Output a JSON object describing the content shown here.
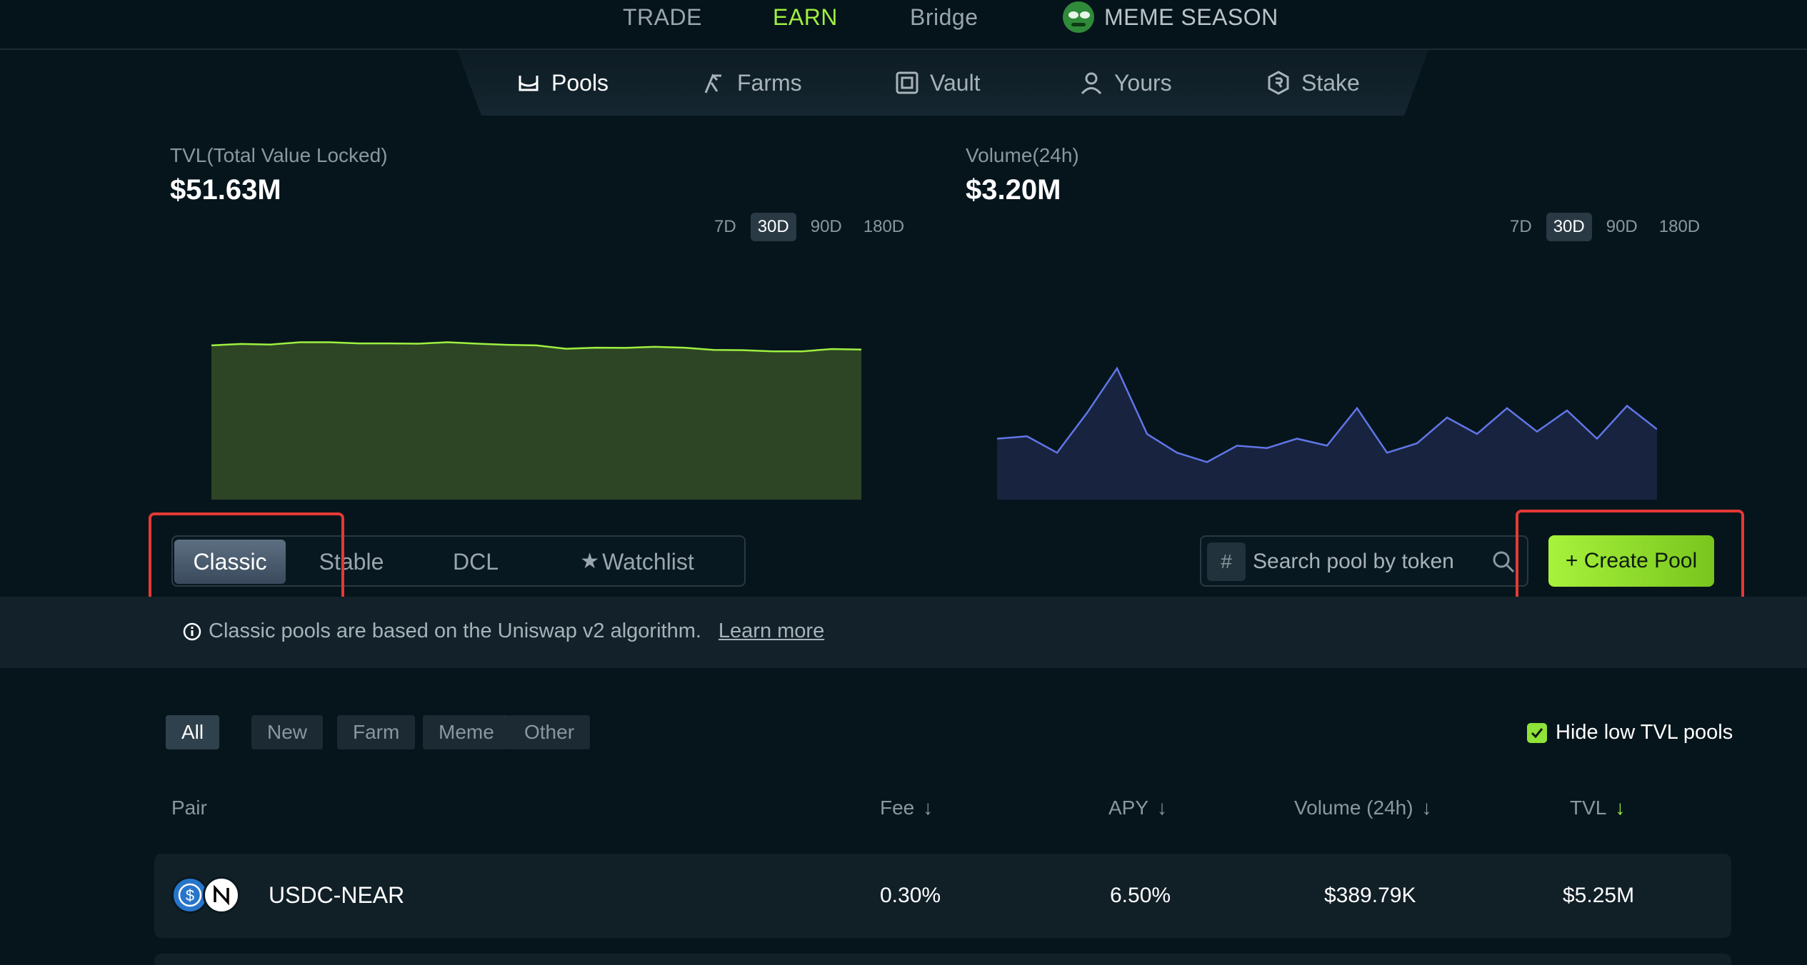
{
  "topnav": {
    "trade": "TRADE",
    "earn": "EARN",
    "bridge": "Bridge",
    "meme": "MEME SEASON"
  },
  "subnav": {
    "pools": "Pools",
    "farms": "Farms",
    "vault": "Vault",
    "yours": "Yours",
    "stake": "Stake"
  },
  "tvl": {
    "label": "TVL(Total Value Locked)",
    "value": "$51.63M",
    "ranges": [
      "7D",
      "30D",
      "90D",
      "180D"
    ],
    "selected_range": "30D"
  },
  "volume": {
    "label": "Volume(24h)",
    "value": "$3.20M",
    "ranges": [
      "7D",
      "30D",
      "90D",
      "180D"
    ],
    "selected_range": "30D"
  },
  "tvl_chart": {
    "type": "area",
    "color": "#9ef040",
    "fill": "#2d4524",
    "values": [
      54.5,
      55.0,
      54.8,
      55.6,
      55.6,
      55.2,
      55.2,
      55.1,
      55.6,
      55.1,
      54.7,
      54.5,
      53.3,
      53.7,
      53.6,
      54.0,
      53.7,
      52.9,
      52.8,
      52.4,
      52.4,
      53.2,
      53.0
    ]
  },
  "volume_chart": {
    "type": "area",
    "color": "#6176e8",
    "fill": "#18233f",
    "values": [
      2.6,
      2.7,
      2.0,
      3.7,
      5.6,
      2.8,
      2.0,
      1.6,
      2.3,
      2.2,
      2.6,
      2.3,
      3.9,
      2.0,
      2.4,
      3.5,
      2.8,
      3.9,
      2.9,
      3.8,
      2.6,
      4.0,
      3.0
    ]
  },
  "tabs": [
    "Classic",
    "Stable",
    "DCL",
    "Watchlist"
  ],
  "active_tab": "Classic",
  "search": {
    "placeholder": "Search pool by token",
    "hash": "#"
  },
  "create_pool": "+ Create Pool",
  "info": {
    "text": "Classic pools are based on the Uniswap v2 algorithm.",
    "link": "Learn more"
  },
  "filters": [
    "All",
    "New",
    "Farm",
    "Meme",
    "Other"
  ],
  "active_filter": "All",
  "hide_low_tvl": {
    "label": "Hide low TVL pools",
    "checked": true
  },
  "table": {
    "headers": {
      "pair": "Pair",
      "fee": "Fee",
      "apy": "APY",
      "volume": "Volume (24h)",
      "tvl": "TVL"
    },
    "rows": [
      {
        "pair": "USDC-NEAR",
        "fee": "0.30%",
        "apy": "6.50%",
        "volume": "$389.79K",
        "tvl": "$5.25M"
      }
    ]
  }
}
